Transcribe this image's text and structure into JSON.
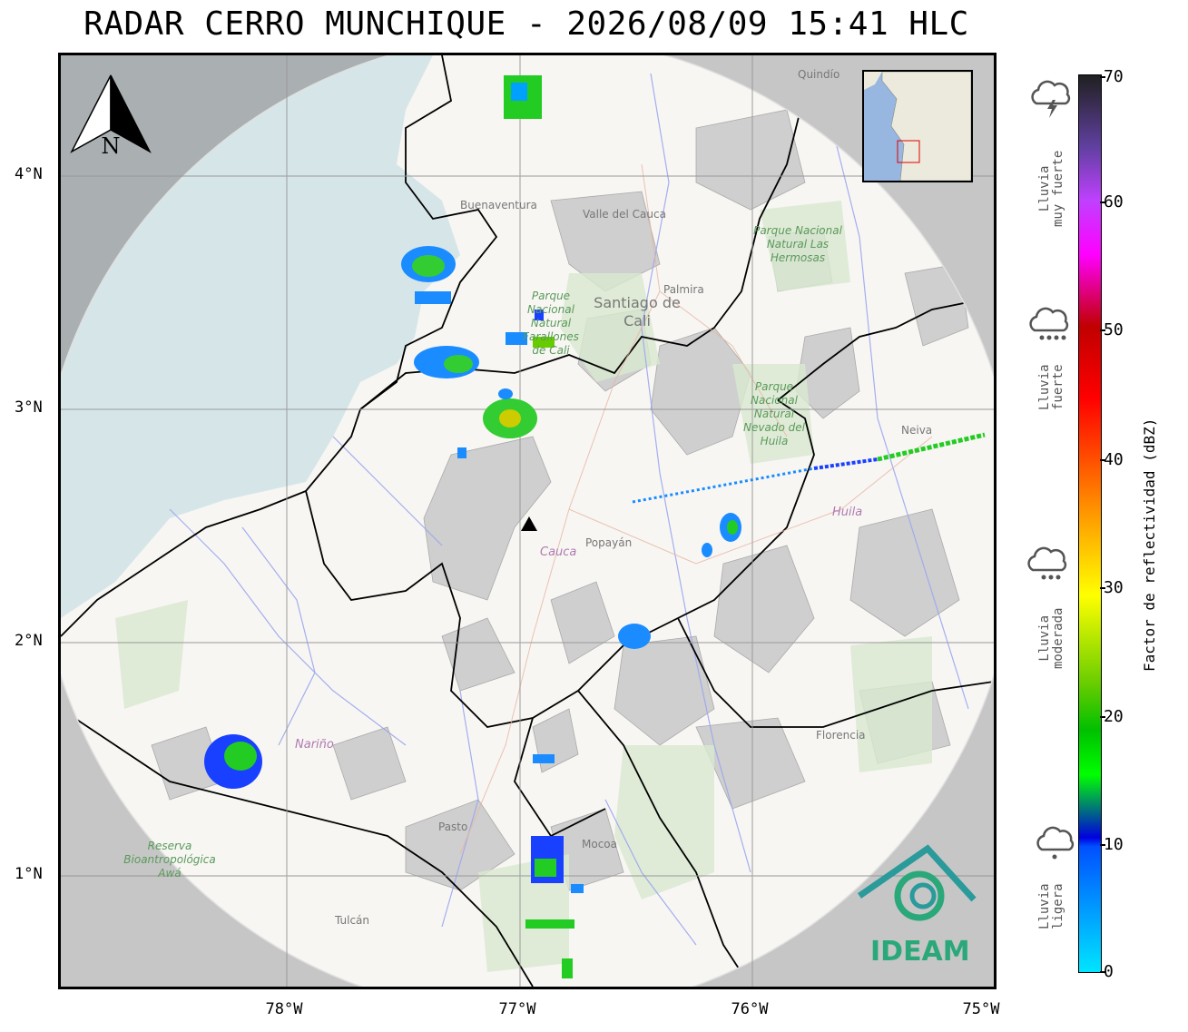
{
  "title": "RADAR CERRO MUNCHIQUE - 2026/08/09 15:41 HLC",
  "north_label": "N",
  "lat_labels": [
    "4°N",
    "3°N",
    "2°N",
    "1°N"
  ],
  "lon_labels": [
    "78°W",
    "77°W",
    "76°W",
    "75°W"
  ],
  "colorbar": {
    "label": "Factor de reflectividad (dBZ)",
    "ticks": [
      "70",
      "60",
      "50",
      "40",
      "30",
      "20",
      "10",
      "0"
    ]
  },
  "legend": [
    {
      "text": "Lluvia muy fuerte",
      "line1": "Lluvia",
      "line2": "muy fuerte",
      "icon": "thunderstorm-icon"
    },
    {
      "text": "Lluvia fuerte",
      "line1": "Lluvia",
      "line2": "fuerte",
      "icon": "heavy-rain-icon"
    },
    {
      "text": "Lluvia moderada",
      "line1": "Lluvia",
      "line2": "moderada",
      "icon": "moderate-rain-icon"
    },
    {
      "text": "Lluvia ligera",
      "line1": "Lluvia",
      "line2": "ligera",
      "icon": "light-rain-icon"
    }
  ],
  "logo_text": "IDEAM",
  "places": {
    "buenaventura": "Buenaventura",
    "valle": "Valle del Cauca",
    "palmira": "Palmira",
    "cali": "Santiago de Cali",
    "popayan": "Popayán",
    "cauca": "Cauca",
    "huila": "Huila",
    "neiva": "Neiva",
    "narino": "Nariño",
    "pasto": "Pasto",
    "mocoa": "Mocoa",
    "florencia": "Florencia",
    "tulcan": "Tulcán",
    "quindio": "Quindío"
  },
  "parks": {
    "farallones": "Parque Nacional Natural Farallones de Cali",
    "hermosas": "Parque Nacional Natural Las Hermosas",
    "nevado": "Parque Nacional Natural Nevado del Huila",
    "awa": "Reserva Bioantropológica Awá"
  },
  "colors": {
    "sea": "#d6e6e8",
    "land": "#f7f6f3",
    "out_of_range": "#c6c6c6",
    "logo": "#2aa87a"
  }
}
